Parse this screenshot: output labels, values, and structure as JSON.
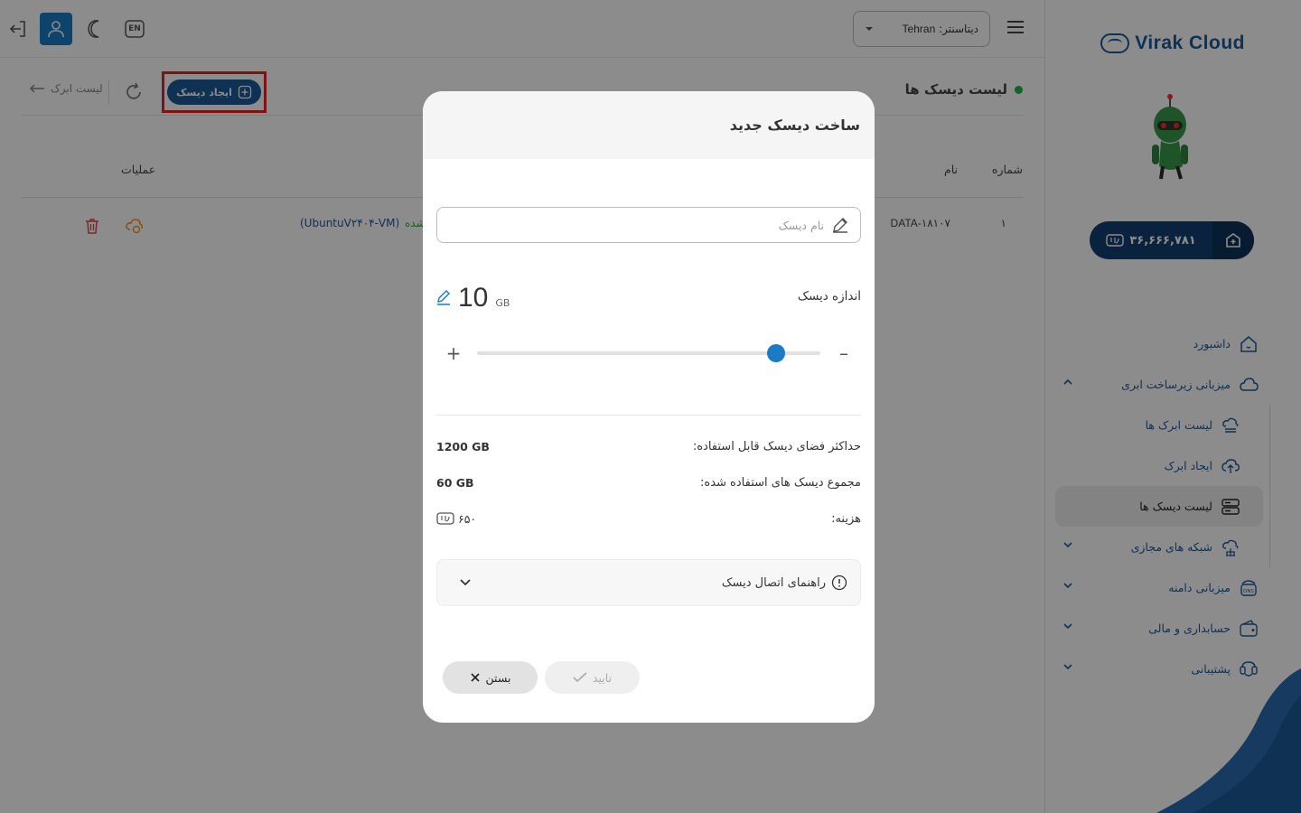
{
  "brand": {
    "name": "Virak Cloud"
  },
  "wallet": {
    "amount": "۳۶,۶۶۶,۷۸۱"
  },
  "sidebar": {
    "items": [
      {
        "label": "داشبورد"
      },
      {
        "label": "میزبانی زیرساخت ابری"
      },
      {
        "label": "لیست ابرک ها"
      },
      {
        "label": "ایجاد ابرک"
      },
      {
        "label": "لیست دیسک ها"
      },
      {
        "label": "شبکه های مجازی"
      },
      {
        "label": "میزبانی دامنه"
      },
      {
        "label": "حسابداری و مالی"
      },
      {
        "label": "پشتیبانی"
      }
    ]
  },
  "topbar": {
    "datacenter_label": "دیتاسنتر:",
    "datacenter_value": "Tehran",
    "lang": "EN"
  },
  "page": {
    "title": "لیست دیسک ها",
    "create_button": "ایجاد دیسک",
    "back_label": "لیست ابرک"
  },
  "table": {
    "headers": {
      "number": "شماره",
      "name": "نام",
      "actions": "عملیات"
    },
    "rows": [
      {
        "number": "۱",
        "name": "DATA-۱۸۱۰۷",
        "vm": "(UbuntuV۲۴۰۴-VM)",
        "status": "شده"
      }
    ]
  },
  "modal": {
    "title": "ساخت دیسک جدید",
    "name_placeholder": "نام دیسک",
    "size_label": "اندازه دیسک",
    "size_value": "10",
    "size_unit": "GB",
    "slider_fraction": 0.87,
    "max_label": "حداکثر فضای دیسک قابل استفاده:",
    "max_value": "1200 GB",
    "used_label": "مجموع دیسک های استفاده شده:",
    "used_value": "60 GB",
    "cost_label": "هزینه:",
    "cost_value": "۶۵۰",
    "guide_label": "راهنمای اتصال دیسک",
    "confirm_label": "تایید",
    "close_label": "بستن"
  },
  "colors": {
    "primary": "#1b5a9a",
    "accent": "#1b7bc4",
    "highlight": "#e32323",
    "status": "#25b24a"
  }
}
